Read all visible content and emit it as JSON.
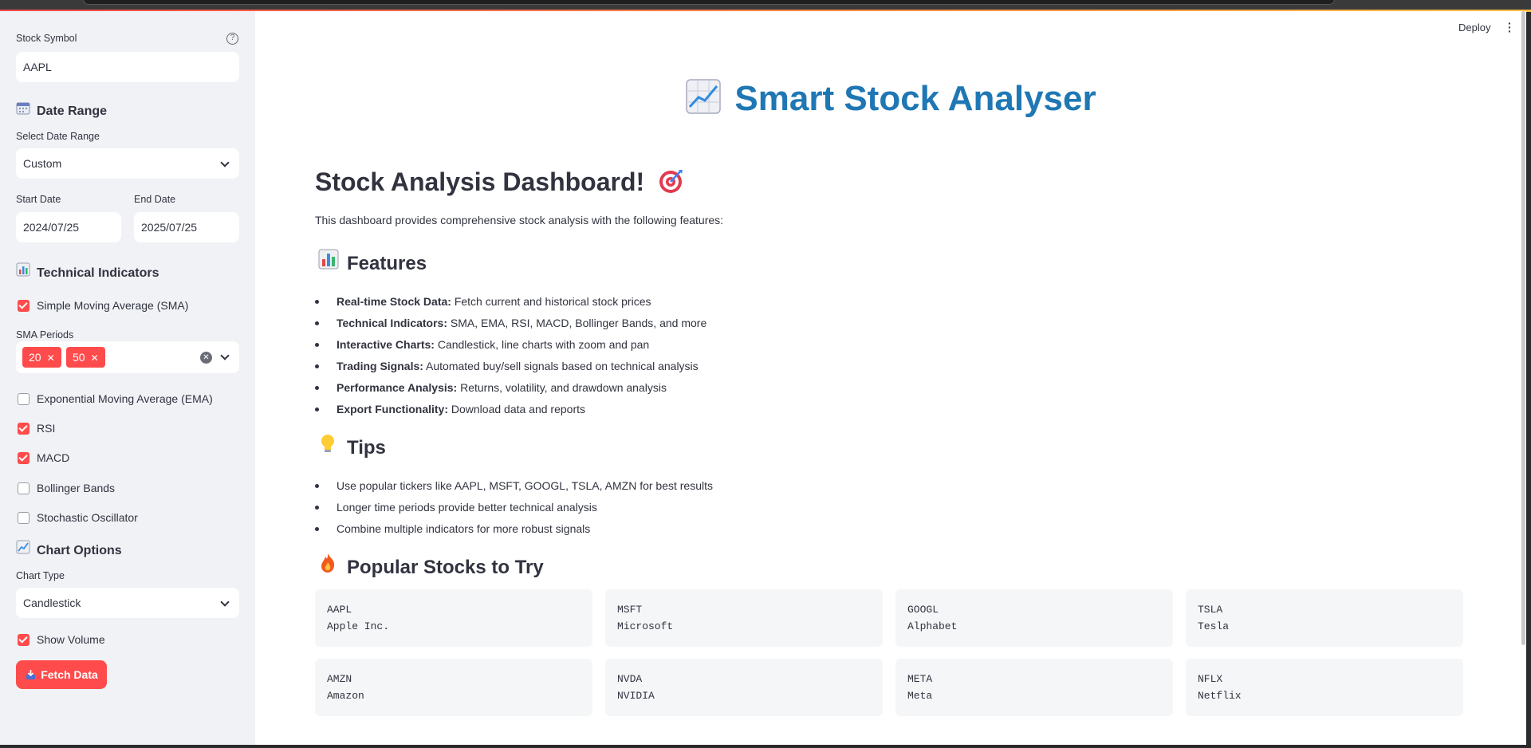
{
  "sidebar": {
    "stock_symbol_label": "Stock Symbol",
    "stock_symbol_value": "AAPL",
    "date_range_heading": "Date Range",
    "date_range_icon": "calendar-icon",
    "select_date_range_label": "Select Date Range",
    "select_date_range_value": "Custom",
    "start_date_label": "Start Date",
    "start_date_value": "2024/07/25",
    "end_date_label": "End Date",
    "end_date_value": "2025/07/25",
    "technical_indicators_heading": "Technical Indicators",
    "technical_indicators_icon": "bar-chart-icon",
    "sma_label": "Simple Moving Average (SMA)",
    "sma_checked": true,
    "sma_periods_label": "SMA Periods",
    "sma_periods": [
      "20",
      "50"
    ],
    "ema_label": "Exponential Moving Average (EMA)",
    "ema_checked": false,
    "rsi_label": "RSI",
    "rsi_checked": true,
    "macd_label": "MACD",
    "macd_checked": true,
    "bollinger_label": "Bollinger Bands",
    "bollinger_checked": false,
    "stochastic_label": "Stochastic Oscillator",
    "stochastic_checked": false,
    "chart_options_heading": "Chart Options",
    "chart_options_icon": "chart-increasing-icon",
    "chart_type_label": "Chart Type",
    "chart_type_value": "Candlestick",
    "show_volume_label": "Show Volume",
    "show_volume_checked": true,
    "fetch_button_label": "Fetch Data",
    "fetch_button_icon": "inbox-tray-icon"
  },
  "header": {
    "deploy_label": "Deploy"
  },
  "main": {
    "title": "Smart Stock Analyser",
    "title_icon": "chart-increasing-icon",
    "dashboard_heading": "Stock Analysis Dashboard!",
    "dashboard_icon": "direct-hit-icon",
    "intro": "This dashboard provides comprehensive stock analysis with the following features:",
    "features_heading": "Features",
    "features_icon": "bar-chart-icon",
    "features": [
      {
        "bold": "Real-time Stock Data:",
        "text": " Fetch current and historical stock prices"
      },
      {
        "bold": "Technical Indicators:",
        "text": " SMA, EMA, RSI, MACD, Bollinger Bands, and more"
      },
      {
        "bold": "Interactive Charts:",
        "text": " Candlestick, line charts with zoom and pan"
      },
      {
        "bold": "Trading Signals:",
        "text": " Automated buy/sell signals based on technical analysis"
      },
      {
        "bold": "Performance Analysis:",
        "text": " Returns, volatility, and drawdown analysis"
      },
      {
        "bold": "Export Functionality:",
        "text": " Download data and reports"
      }
    ],
    "tips_heading": "Tips",
    "tips_icon": "light-bulb-icon",
    "tips": [
      "Use popular tickers like AAPL, MSFT, GOOGL, TSLA, AMZN for best results",
      "Longer time periods provide better technical analysis",
      "Combine multiple indicators for more robust signals"
    ],
    "popular_heading": "Popular Stocks to Try",
    "popular_icon": "fire-icon",
    "popular_stocks": [
      {
        "symbol": "AAPL",
        "name": "Apple Inc."
      },
      {
        "symbol": "MSFT",
        "name": "Microsoft"
      },
      {
        "symbol": "GOOGL",
        "name": "Alphabet"
      },
      {
        "symbol": "TSLA",
        "name": "Tesla"
      },
      {
        "symbol": "AMZN",
        "name": "Amazon"
      },
      {
        "symbol": "NVDA",
        "name": "NVIDIA"
      },
      {
        "symbol": "META",
        "name": "Meta"
      },
      {
        "symbol": "NFLX",
        "name": "Netflix"
      }
    ]
  },
  "colors": {
    "accent": "#ff4b4b",
    "title_blue": "#1f77b4",
    "sidebar_bg": "#f0f2f6"
  }
}
